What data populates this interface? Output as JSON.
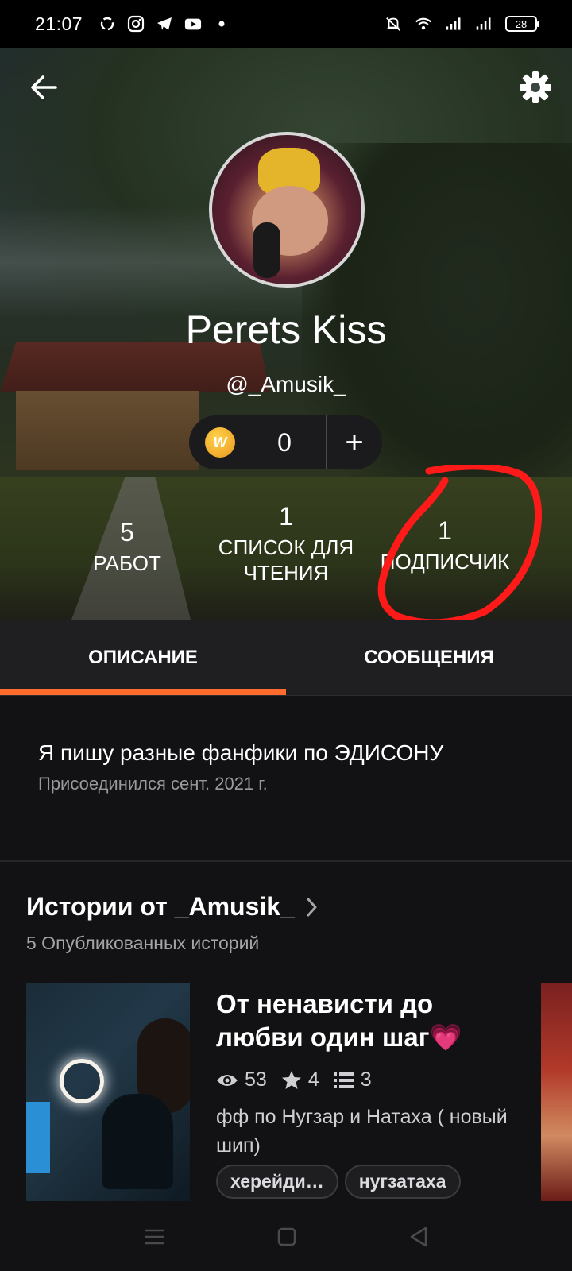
{
  "status_bar": {
    "time": "21:07",
    "battery": "28",
    "icons": [
      "sync-icon",
      "instagram-icon",
      "telegram-icon",
      "youtube-icon",
      "dot-icon",
      "mute-icon",
      "wifi-icon",
      "signal-icon",
      "signal-icon"
    ]
  },
  "profile": {
    "name": "Perets Kiss",
    "handle": "@_Amusik_",
    "coins": "0",
    "coin_add": "+"
  },
  "stats": [
    {
      "value": "5",
      "label": "РАБОТ"
    },
    {
      "value": "1",
      "label": "СПИСОК ДЛЯ ЧТЕНИЯ"
    },
    {
      "value": "1",
      "label": "ПОДПИСЧИК"
    }
  ],
  "tabs": [
    {
      "label": "ОПИСАНИЕ",
      "active": true
    },
    {
      "label": "СООБЩЕНИЯ",
      "active": false
    }
  ],
  "about": {
    "description": "Я пишу разные фанфики по ЭДИСОНУ",
    "joined": "Присоединился сент. 2021 г."
  },
  "stories": {
    "title": "Истории от _Amusik_",
    "subtitle": "5 Опубликованных историй",
    "items": [
      {
        "title": "От ненависти до любви один шаг💗",
        "views": "53",
        "votes": "4",
        "parts": "3",
        "description": "фф по  Нугзар и Натаха ( новый шип)",
        "tags": [
          "херейди…",
          "нугзатаха"
        ]
      }
    ]
  },
  "colors": {
    "accent": "#ff6a2d",
    "background": "#121113",
    "annotation": "#ff1a1a"
  }
}
